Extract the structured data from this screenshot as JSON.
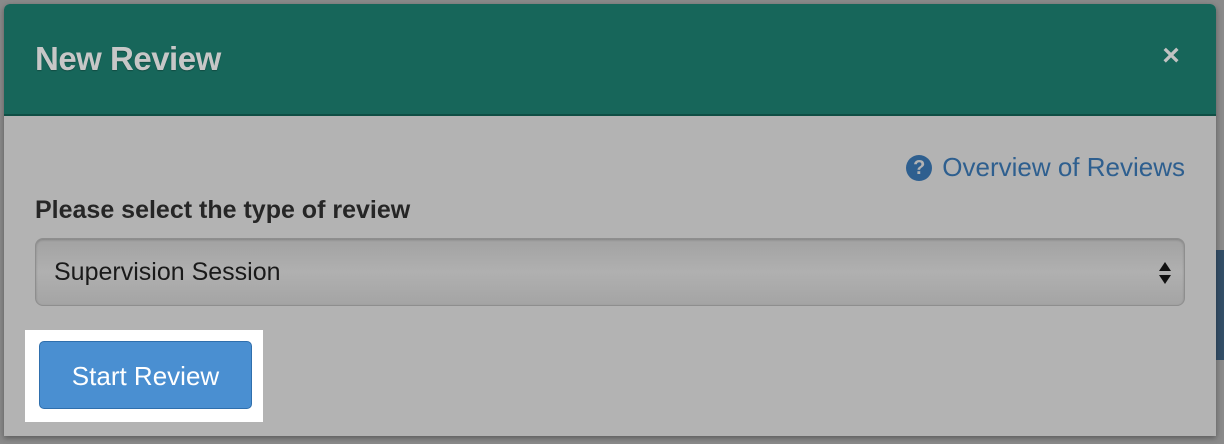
{
  "modal": {
    "title": "New Review",
    "close_label": "×"
  },
  "help": {
    "icon_glyph": "?",
    "icon_name": "question-circle-icon",
    "link_text": "Overview of Reviews"
  },
  "review_type": {
    "label": "Please select the type of review",
    "selected": "Supervision Session"
  },
  "actions": {
    "start_label": "Start Review"
  },
  "colors": {
    "header": "#17665a",
    "link": "#2e5f8f",
    "primary_button": "#4a8fd1"
  }
}
